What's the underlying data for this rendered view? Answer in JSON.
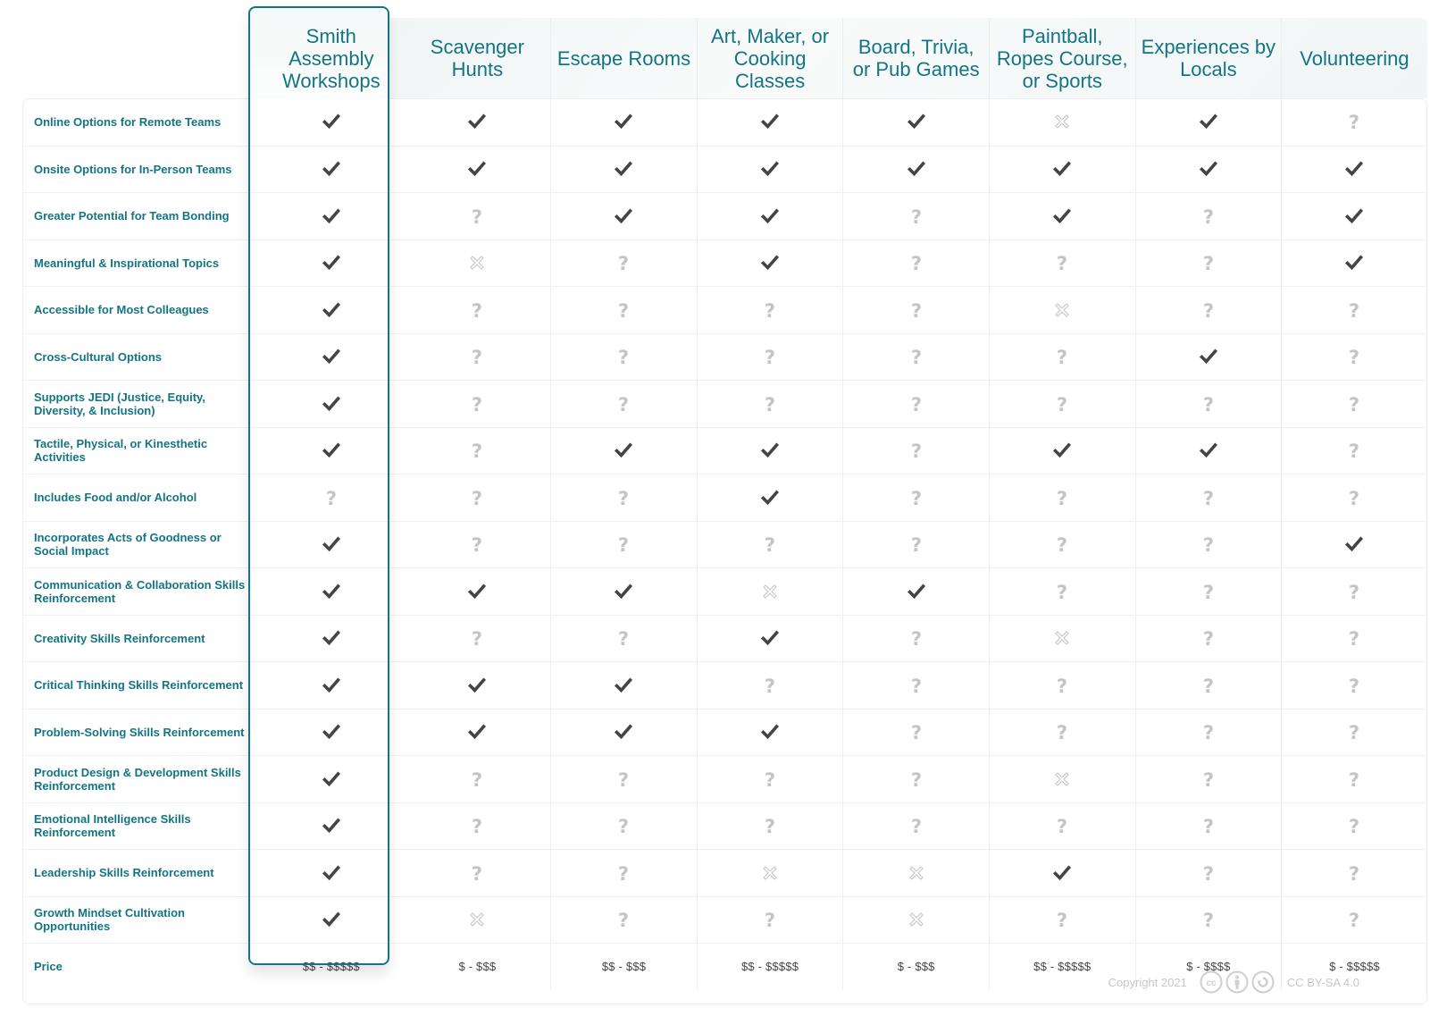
{
  "columns": [
    "Smith Assembly Workshops",
    "Scavenger Hunts",
    "Escape Rooms",
    "Art, Maker, or Cooking Classes",
    "Board, Trivia, or Pub Games",
    "Paintball, Ropes Course, or Sports",
    "Experiences by Locals",
    "Volunteering"
  ],
  "highlighted_column": "Smith Assembly Workshops",
  "legend": {
    "y": "check-icon",
    "n": "cross-icon",
    "u": "question-icon"
  },
  "rows": [
    {
      "label": "Online Options for Remote Teams",
      "values": [
        "y",
        "y",
        "y",
        "y",
        "y",
        "n",
        "y",
        "u"
      ]
    },
    {
      "label": "Onsite Options for In-Person Teams",
      "values": [
        "y",
        "y",
        "y",
        "y",
        "y",
        "y",
        "y",
        "y"
      ]
    },
    {
      "label": "Greater Potential for Team Bonding",
      "values": [
        "y",
        "u",
        "y",
        "y",
        "u",
        "y",
        "u",
        "y"
      ]
    },
    {
      "label": "Meaningful & Inspirational Topics",
      "values": [
        "y",
        "n",
        "u",
        "y",
        "u",
        "u",
        "u",
        "y"
      ]
    },
    {
      "label": "Accessible for Most Colleagues",
      "values": [
        "y",
        "u",
        "u",
        "u",
        "u",
        "n",
        "u",
        "u"
      ]
    },
    {
      "label": "Cross-Cultural Options",
      "values": [
        "y",
        "u",
        "u",
        "u",
        "u",
        "u",
        "y",
        "u"
      ]
    },
    {
      "label": "Supports JEDI (Justice, Equity, Diversity, & Inclusion)",
      "values": [
        "y",
        "u",
        "u",
        "u",
        "u",
        "u",
        "u",
        "u"
      ]
    },
    {
      "label": "Tactile, Physical, or Kinesthetic Activities",
      "values": [
        "y",
        "u",
        "y",
        "y",
        "u",
        "y",
        "y",
        "u"
      ]
    },
    {
      "label": "Includes Food and/or Alcohol",
      "values": [
        "u",
        "u",
        "u",
        "y",
        "u",
        "u",
        "u",
        "u"
      ]
    },
    {
      "label": "Incorporates Acts of Goodness or Social Impact",
      "values": [
        "y",
        "u",
        "u",
        "u",
        "u",
        "u",
        "u",
        "y"
      ]
    },
    {
      "label": "Communication & Collaboration Skills Reinforcement",
      "values": [
        "y",
        "y",
        "y",
        "n",
        "y",
        "u",
        "u",
        "u"
      ]
    },
    {
      "label": "Creativity Skills Reinforcement",
      "values": [
        "y",
        "u",
        "u",
        "y",
        "u",
        "n",
        "u",
        "u"
      ]
    },
    {
      "label": "Critical Thinking Skills Reinforcement",
      "values": [
        "y",
        "y",
        "y",
        "u",
        "u",
        "u",
        "u",
        "u"
      ]
    },
    {
      "label": "Problem-Solving Skills Reinforcement",
      "values": [
        "y",
        "y",
        "y",
        "y",
        "u",
        "u",
        "u",
        "u"
      ]
    },
    {
      "label": "Product Design & Development Skills Reinforcement",
      "values": [
        "y",
        "u",
        "u",
        "u",
        "u",
        "n",
        "u",
        "u"
      ]
    },
    {
      "label": "Emotional Intelligence Skills Reinforcement",
      "values": [
        "y",
        "u",
        "u",
        "u",
        "u",
        "u",
        "u",
        "u"
      ]
    },
    {
      "label": "Leadership Skills Reinforcement",
      "values": [
        "y",
        "u",
        "u",
        "n",
        "n",
        "y",
        "u",
        "u"
      ]
    },
    {
      "label": "Growth Mindset Cultivation Opportunities",
      "values": [
        "y",
        "n",
        "u",
        "u",
        "n",
        "u",
        "u",
        "u"
      ]
    }
  ],
  "price_row": {
    "label": "Price",
    "values": [
      "$$ - $$$$$",
      "$ - $$$",
      "$$ - $$$",
      "$$ - $$$$$",
      "$ - $$$",
      "$$ - $$$$$",
      "$ - $$$$",
      "$ - $$$$$"
    ]
  },
  "footer": {
    "copyright": "Copyright 2021",
    "license": "CC BY-SA 4.0",
    "license_icons": [
      "cc-icon",
      "attribution-icon",
      "share-alike-icon"
    ]
  },
  "colors": {
    "accent": "#137584",
    "check": "#444444",
    "muted": "#c4c4c4"
  }
}
